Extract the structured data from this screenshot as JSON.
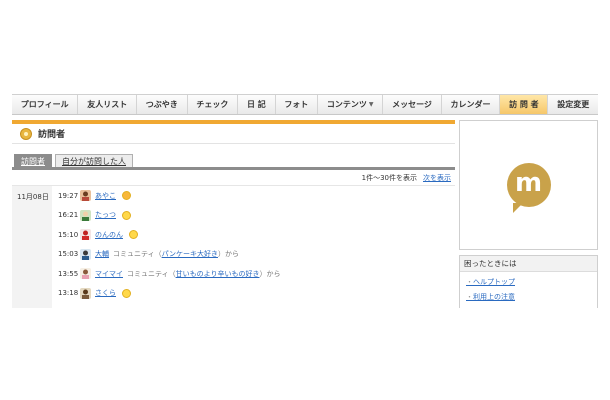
{
  "nav": {
    "items": [
      {
        "label": "プロフィール"
      },
      {
        "label": "友人リスト"
      },
      {
        "label": "つぶやき"
      },
      {
        "label": "チェック"
      },
      {
        "label": "日 記"
      },
      {
        "label": "フォト"
      },
      {
        "label": "コンテンツ"
      },
      {
        "label": "メッセージ"
      },
      {
        "label": "カレンダー"
      },
      {
        "label": "訪 問 者"
      },
      {
        "label": "設定変更"
      }
    ],
    "active_index": 9,
    "accent_color": "#f0a832"
  },
  "section": {
    "title": "訪問者",
    "icon": "visitor-icon"
  },
  "tabs": [
    {
      "label": "訪問者"
    },
    {
      "label": "自分が訪問した人"
    }
  ],
  "pager": {
    "summary": "1件～30件を表示",
    "next_label": "次を表示"
  },
  "visits": {
    "date": "11月08日",
    "rows": [
      {
        "time": "19:27",
        "name": "あやこ",
        "community": "",
        "community_link": "",
        "suffix": "",
        "face": "orange"
      },
      {
        "time": "16:21",
        "name": "たっつ",
        "community": "",
        "community_link": "",
        "suffix": "",
        "face": "yellow"
      },
      {
        "time": "15:10",
        "name": "のんのん",
        "community": "",
        "community_link": "",
        "suffix": "",
        "face": "yellow"
      },
      {
        "time": "15:03",
        "name": "大輔",
        "community": "コミュニティ（",
        "community_link": "パンケーキ大好き",
        "suffix": "）から",
        "face": ""
      },
      {
        "time": "13:55",
        "name": "マイマイ",
        "community": "コミュニティ（",
        "community_link": "甘いものより辛いもの好き",
        "suffix": "）から",
        "face": ""
      },
      {
        "time": "13:18",
        "name": "さくら",
        "community": "",
        "community_link": "",
        "suffix": "",
        "face": "yellow"
      }
    ]
  },
  "sidebar": {
    "logo_letter": "m",
    "help_title": "困ったときには",
    "help_links": [
      "ヘルプトップ",
      "利用上の注意"
    ]
  }
}
